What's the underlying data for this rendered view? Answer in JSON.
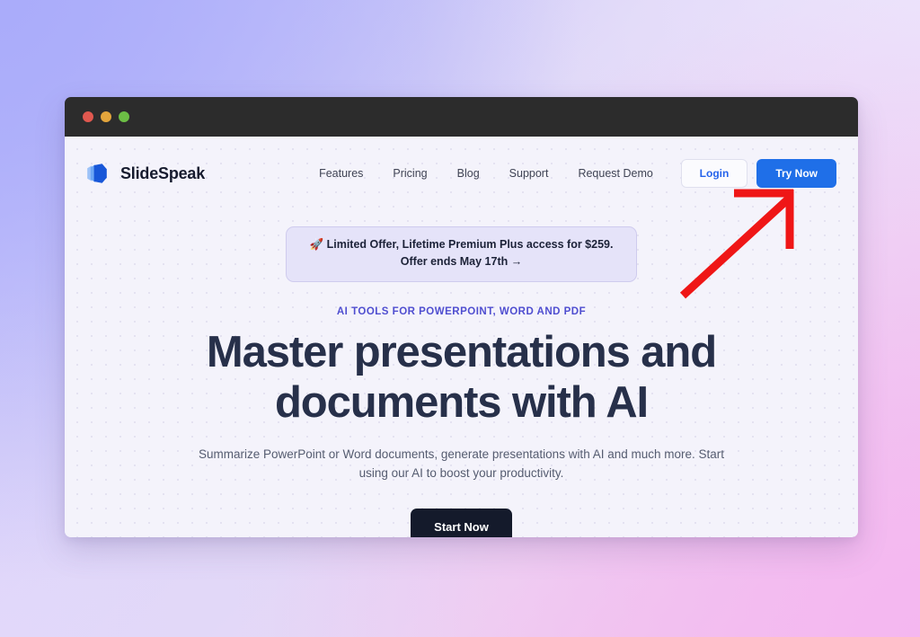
{
  "window": {
    "traffic_lights": [
      "close",
      "minimize",
      "maximize"
    ]
  },
  "site": {
    "brand": {
      "name": "SlideSpeak",
      "logo_icon": "slidespeak-cube-icon",
      "logo_colors": [
        "#8fb7f6",
        "#1857d8"
      ]
    },
    "nav": [
      {
        "label": "Features"
      },
      {
        "label": "Pricing"
      },
      {
        "label": "Blog"
      },
      {
        "label": "Support"
      },
      {
        "label": "Request Demo"
      }
    ],
    "actions": {
      "login_label": "Login",
      "try_now_label": "Try Now",
      "login_color": "#2563eb",
      "try_now_bg": "#1f6fe8"
    }
  },
  "hero": {
    "promo": {
      "icon": "rocket-icon",
      "line1": "Limited Offer, Lifetime Premium Plus access for $259.",
      "line2": "Offer ends May 17th →",
      "bg": "#e5e3f9"
    },
    "eyebrow": "AI TOOLS FOR POWERPOINT, WORD AND PDF",
    "eyebrow_color": "#4f4ed0",
    "headline": "Master presentations and documents with AI",
    "subheadline": "Summarize PowerPoint or Word documents, generate presentations with AI and much more. Start using our AI to boost your productivity.",
    "cta_label": "Start Now",
    "cta_bg": "#141a2b"
  },
  "annotation": {
    "arrow_icon": "red-arrow-up-right-icon",
    "arrow_color": "#ef1616",
    "points_to": "Try Now"
  }
}
